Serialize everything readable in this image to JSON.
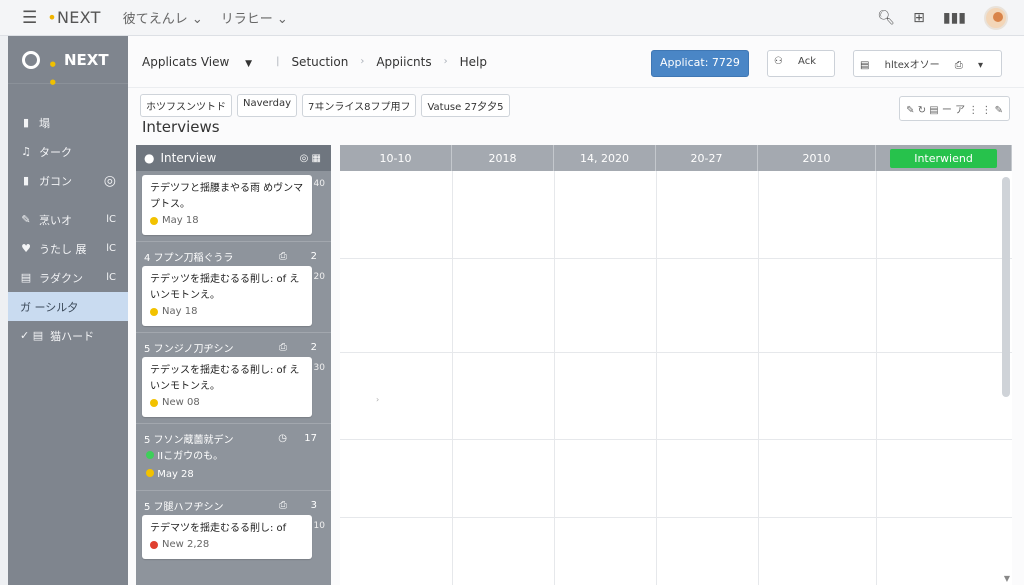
{
  "topbar": {
    "brand_prefix": "•",
    "brand": "NEXT",
    "menu": [
      "彼てえんレ ⌄",
      "リラヒー ⌄"
    ],
    "right_icons": [
      "search-icon",
      "grid-icon",
      "bars-icon"
    ]
  },
  "sidebar": {
    "logo_prefix": "• •",
    "logo": "NEXT",
    "items": [
      {
        "icon": "▮",
        "label": "塌",
        "tail": ""
      },
      {
        "icon": "♫",
        "label": "ターク",
        "tail": ""
      },
      {
        "icon": "▮",
        "label": "ガコン",
        "tail": "◎"
      },
      {
        "icon": "✎",
        "label": "烹いオ",
        "tail": "lC"
      },
      {
        "icon": "♥",
        "label": "うたし 展",
        "tail": "lC"
      },
      {
        "icon": "▤",
        "label": "ラダクン",
        "tail": "lC"
      },
      {
        "icon": "",
        "label": "ガ ーシル夕",
        "tail": ""
      },
      {
        "icon": "✓ ▤",
        "label": "猫ハード",
        "tail": ""
      }
    ]
  },
  "main": {
    "crumbs": [
      "Applicats View",
      "Setuction",
      "Appiicnts",
      "Help"
    ],
    "primary_button": "Applicat: 7729",
    "ack_button": "Ack",
    "filter_button": "hltexオソー",
    "filters": [
      "ホツフスンツトド",
      "Naverday",
      "7ヰンライス8フプ用フ",
      "Vatuse 27夕夕5"
    ],
    "tools": "✎ ↻  ▤ ー ア ⋮ ⋮  ✎",
    "title": "Interviews"
  },
  "lane": {
    "header": "Interview",
    "groups": [
      {
        "header": "",
        "icon": "",
        "count": "",
        "card_text": "テデツフと揺腰まやる雨 めヴンマプトス。",
        "card_meta": "May 18",
        "meta_color": "#f2c200",
        "side_num": "40"
      },
      {
        "header": "4 フプン刀稲ぐうラ",
        "icon": "⎙",
        "count": "2",
        "card_text": "テデッツを揺走むるる削し: of えいンモトンえ。",
        "card_meta": "Nay 18",
        "meta_color": "#f2c200",
        "side_num": "20"
      },
      {
        "header": "5 フンジノ刀ヂシン",
        "icon": "⎙",
        "count": "2",
        "card_text": "テデッスを揺走むるる削し: of えいンモトンえ。",
        "card_meta": "New 08",
        "meta_color": "#f2c200",
        "side_num": "30"
      },
      {
        "header": "5 フソン蔵薗就デン",
        "icon": "◷",
        "count": "17",
        "card_text": "",
        "card_meta": "",
        "meta_color": "",
        "side_num": ""
      },
      {
        "header": "5 フ腿ハフヂシン",
        "icon": "⎙",
        "count": "3",
        "card_text": "テデマツを揺走むるる削し: of",
        "card_meta": "New 2,28",
        "meta_color": "#e04030",
        "side_num": "10"
      }
    ],
    "extra_lines": [
      {
        "color": "#3ecf5a",
        "text": "IIこガウのも。"
      },
      {
        "color": "#f2c200",
        "text": "May 28"
      }
    ]
  },
  "grid": {
    "columns": [
      "10-10",
      "2018",
      "14, 2020",
      "20-27",
      "2010",
      "Interwiend"
    ],
    "green_accent": "#27c24c"
  }
}
